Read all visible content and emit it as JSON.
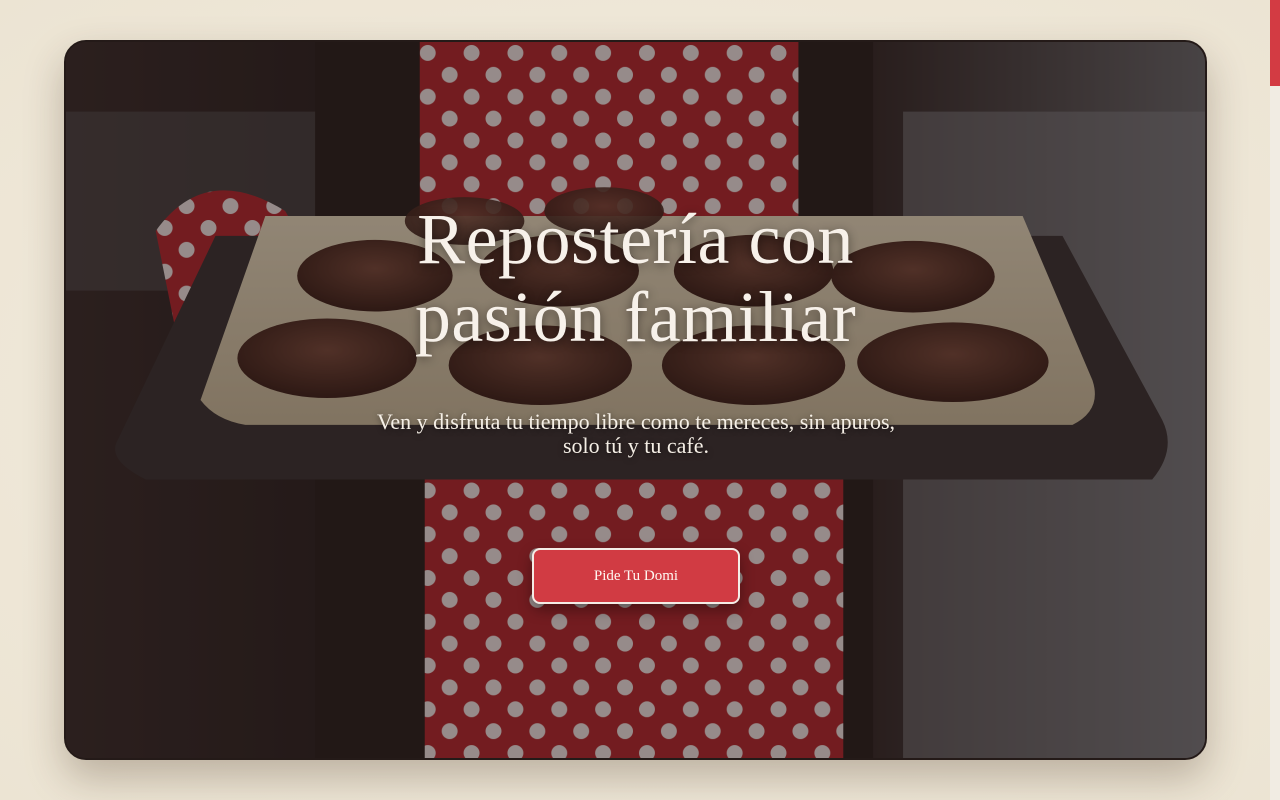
{
  "hero": {
    "title_line1": "Repostería con",
    "title_line2": "pasión familiar",
    "subtitle": "Ven y disfruta tu tiempo libre como te mereces, sin apuros, solo tú y tu café.",
    "cta_label": "Pide Tu Domi",
    "image_description_icon": "muffin-tray-photo"
  },
  "colors": {
    "accent": "#d13b43",
    "page_background": "#efe8d9",
    "hero_text": "#f7f1ea",
    "scrollbar_thumb": "#d33b43"
  }
}
